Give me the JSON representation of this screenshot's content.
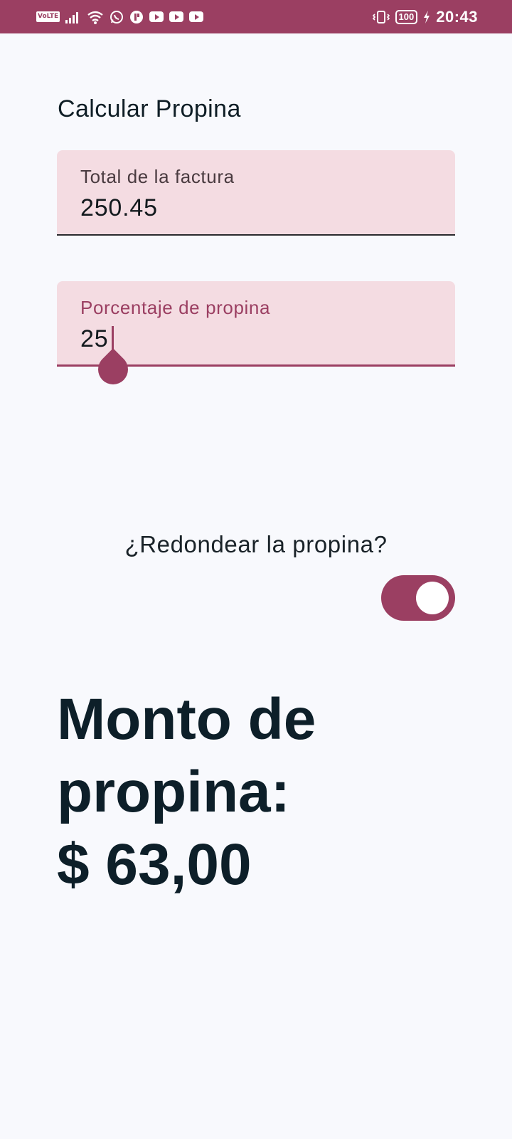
{
  "status_bar": {
    "network_badge": "VoLTE",
    "battery_level": "100",
    "time": "20:43",
    "icons": [
      "signal-icon",
      "wifi-icon",
      "whatsapp-icon",
      "app-icon",
      "youtube-icon",
      "youtube-icon",
      "youtube-icon",
      "vibrate-icon",
      "battery-icon",
      "charging-icon"
    ],
    "color": "#9b3f62"
  },
  "screen": {
    "title": "Calcular Propina",
    "bill_field": {
      "label": "Total de la factura",
      "value": "250.45"
    },
    "tip_field": {
      "label": "Porcentaje de propina",
      "value": "25",
      "focused": true
    },
    "round_switch": {
      "label": "¿Redondear la propina?",
      "checked": true
    },
    "result": {
      "line1": "Monto de",
      "line2": "propina:",
      "line3": "$ 63,00"
    }
  },
  "colors": {
    "accent": "#9b3f62",
    "field_bg": "#f4dce2",
    "background": "#f8f9fd",
    "text_dark": "#0d1f29"
  }
}
